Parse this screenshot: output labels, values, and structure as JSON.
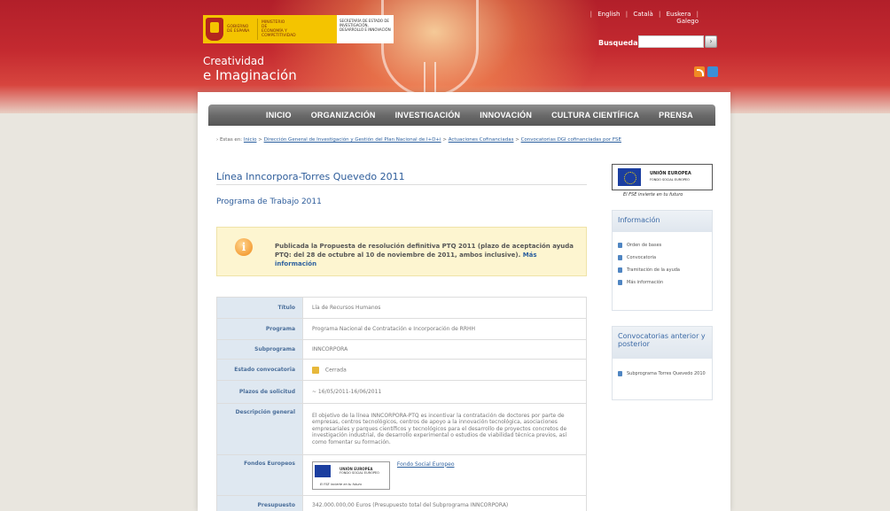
{
  "header": {
    "site_title_line1": "Creatividad",
    "site_title_line2": "e Imaginación",
    "gov_logo": {
      "text_gobierno": "GOBIERNO DE ESPAÑA",
      "text_ministerio": "MINISTERIO DE ECONOMÍA Y COMPETITIVIDAD",
      "text_secretaria": "SECRETARÍA DE ESTADO DE INVESTIGACIÓN, DESARROLLO E INNOVACIÓN"
    },
    "languages": [
      "English",
      "Català",
      "Euskera",
      "Galego"
    ],
    "search_label": "Busqueda",
    "search_value": ""
  },
  "nav": {
    "items": [
      "INICIO",
      "ORGANIZACIÓN",
      "INVESTIGACIÓN",
      "INNOVACIÓN",
      "CULTURA CIENTÍFICA",
      "PRENSA"
    ]
  },
  "breadcrumb": {
    "prefix": "Estas en:",
    "items": [
      "Inicio",
      "Dirección General de Investigación y Gestión del Plan Nacional de I+D+i",
      "Actuaciones Cofinanciadas",
      "Convocatorias DGI cofinanciadas por FSE"
    ],
    "separator": ">"
  },
  "main": {
    "title": "Línea Inncorpora-Torres Quevedo 2011",
    "subtitle": "Programa de Trabajo 2011",
    "notice": {
      "text": "Publicada la Propuesta de resolución definitiva PTQ 2011 (plazo de aceptación ayuda PTQ: del 28 de octubre al 10 de noviembre de 2011, ambos inclusive).",
      "link": "Más información"
    },
    "details": {
      "titulo_label": "Título",
      "titulo": "Lía de Recursos Humanos",
      "programa_label": "Programa",
      "programa": "Programa Nacional de Contratación e Incorporación de RRHH",
      "subprograma_label": "Subprograma",
      "subprograma": "INNCORPORA",
      "estado_label": "Estado convocatoria",
      "estado": "Cerrada",
      "plazos_label": "Plazos de solicitud",
      "plazos": "~ 16/05/2011-16/06/2011",
      "descripcion_label": "Descripción general",
      "descripcion": "El objetivo de la línea INNCORPORA-PTQ es incentivar la contratación de doctores por parte de empresas, centros tecnológicos, centros de apoyo a la innovación tecnológica, asociaciones empresariales y parques científicos y tecnológicos para el desarrollo de proyectos concretos de investigación industrial, de desarrollo experimental o estudios de viabilidad técnica previos, así como fomentar su formación.",
      "fondos_label": "Fondos Europeos",
      "fondos_link": "Fondo Social Europeo",
      "presupuesto_label": "Presupuesto",
      "presupuesto": "342.000.000,00 Euros (Presupuesto total del Subprograma INNCORPORA)"
    },
    "eu_mini": {
      "line1": "UNIÓN EUROPEA",
      "line2": "FONDO SOCIAL EUROPEO",
      "caption": "El FSE invierte en tu futuro"
    }
  },
  "sidebar": {
    "eu_logo": {
      "line1": "UNIÓN EUROPEA",
      "line2": "FONDO SOCIAL EUROPEO",
      "caption": "El FSE invierte en tu futuro"
    },
    "info_panel": {
      "title": "Información",
      "links": [
        "Orden de bases",
        "Convocatoria",
        "Tramitación de la ayuda",
        "Más información"
      ]
    },
    "conv_panel": {
      "title": "Convocatorias anterior y posterior",
      "links": [
        "Subprograma Torres Quevedo 2010"
      ]
    }
  },
  "colors": {
    "header_red": "#b21f2a",
    "nav_gray": "#6a6a6a",
    "link_blue": "#2b5f9e",
    "notice_bg": "#fdf5d0",
    "table_key_bg": "#dfe8f1"
  }
}
